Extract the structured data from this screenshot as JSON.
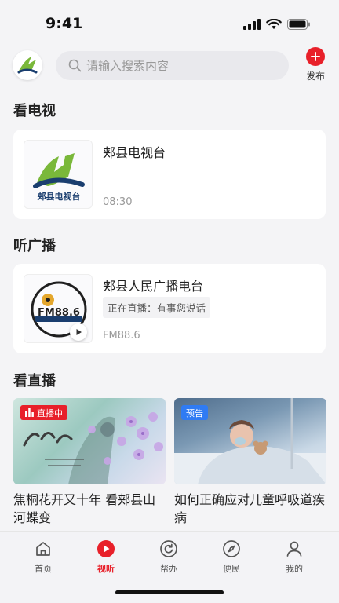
{
  "status": {
    "time": "9:41"
  },
  "header": {
    "search_placeholder": "请输入搜索内容",
    "publish_label": "发布"
  },
  "sections": {
    "tv_title": "看电视",
    "radio_title": "听广播",
    "live_title": "看直播"
  },
  "tv": {
    "name": "郏县电视台",
    "logo_text": "郏县电视台",
    "time": "08:30"
  },
  "radio": {
    "name": "郏县人民广播电台",
    "now_playing": "正在直播：有事您说话",
    "frequency": "FM88.6",
    "logo_freq": "FM88.6"
  },
  "live": [
    {
      "badge": "直播中",
      "title": "焦桐花开又十年 看郏县山河蝶变",
      "badge_color": "#e8202a"
    },
    {
      "badge": "预告",
      "title": "如何正确应对儿童呼吸道疾病",
      "badge_color": "#2f7bf3"
    }
  ],
  "tabs": [
    {
      "label": "首页",
      "icon": "home-icon"
    },
    {
      "label": "视听",
      "icon": "play-icon",
      "active": true
    },
    {
      "label": "帮办",
      "icon": "refresh-icon"
    },
    {
      "label": "便民",
      "icon": "compass-icon"
    },
    {
      "label": "我的",
      "icon": "user-icon"
    }
  ],
  "colors": {
    "accent": "#e8202a",
    "preview": "#2f7bf3",
    "background": "#f4f4f6"
  }
}
